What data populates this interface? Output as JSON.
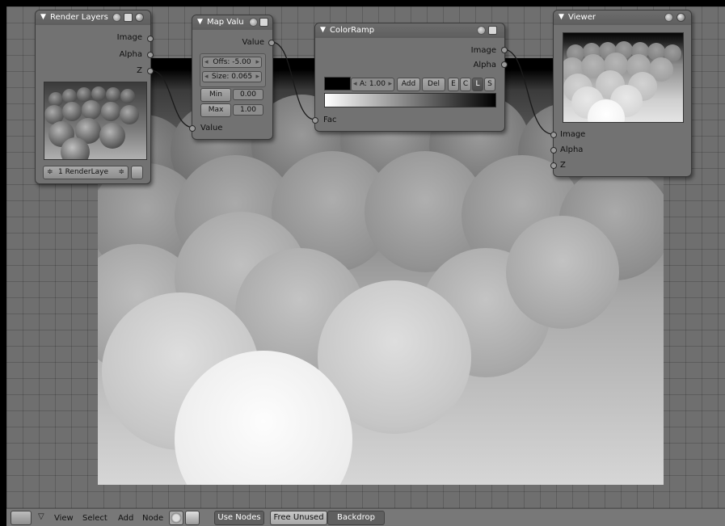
{
  "footer": {
    "menus": [
      "View",
      "Select",
      "Add",
      "Node"
    ],
    "use_nodes": "Use Nodes",
    "free_unused": "Free Unused",
    "backdrop": "Backdrop"
  },
  "nodes": {
    "render_layers": {
      "title": "Render Layers",
      "outputs": [
        "Image",
        "Alpha",
        "Z"
      ],
      "layer_select": "1 RenderLaye"
    },
    "map_value": {
      "title": "Map Valu",
      "output": "Value",
      "input": "Value",
      "offs": "Offs: -5.00",
      "size": "Size: 0.065",
      "min_label": "Min",
      "min_value": "0.00",
      "max_label": "Max",
      "max_value": "1.00"
    },
    "color_ramp": {
      "title": "ColorRamp",
      "outputs": [
        "Image",
        "Alpha"
      ],
      "input": "Fac",
      "alpha": "A: 1.00",
      "add": "Add",
      "del": "Del",
      "e": "E",
      "c": "C",
      "l": "L",
      "s": "S"
    },
    "viewer": {
      "title": "Viewer",
      "inputs": [
        "Image",
        "Alpha",
        "Z"
      ]
    }
  },
  "icons": [
    "editor-type-icon",
    "chevron-down-icon",
    "sphere-icon",
    "image-icon",
    "node-add-icon",
    "collapse-icon"
  ]
}
